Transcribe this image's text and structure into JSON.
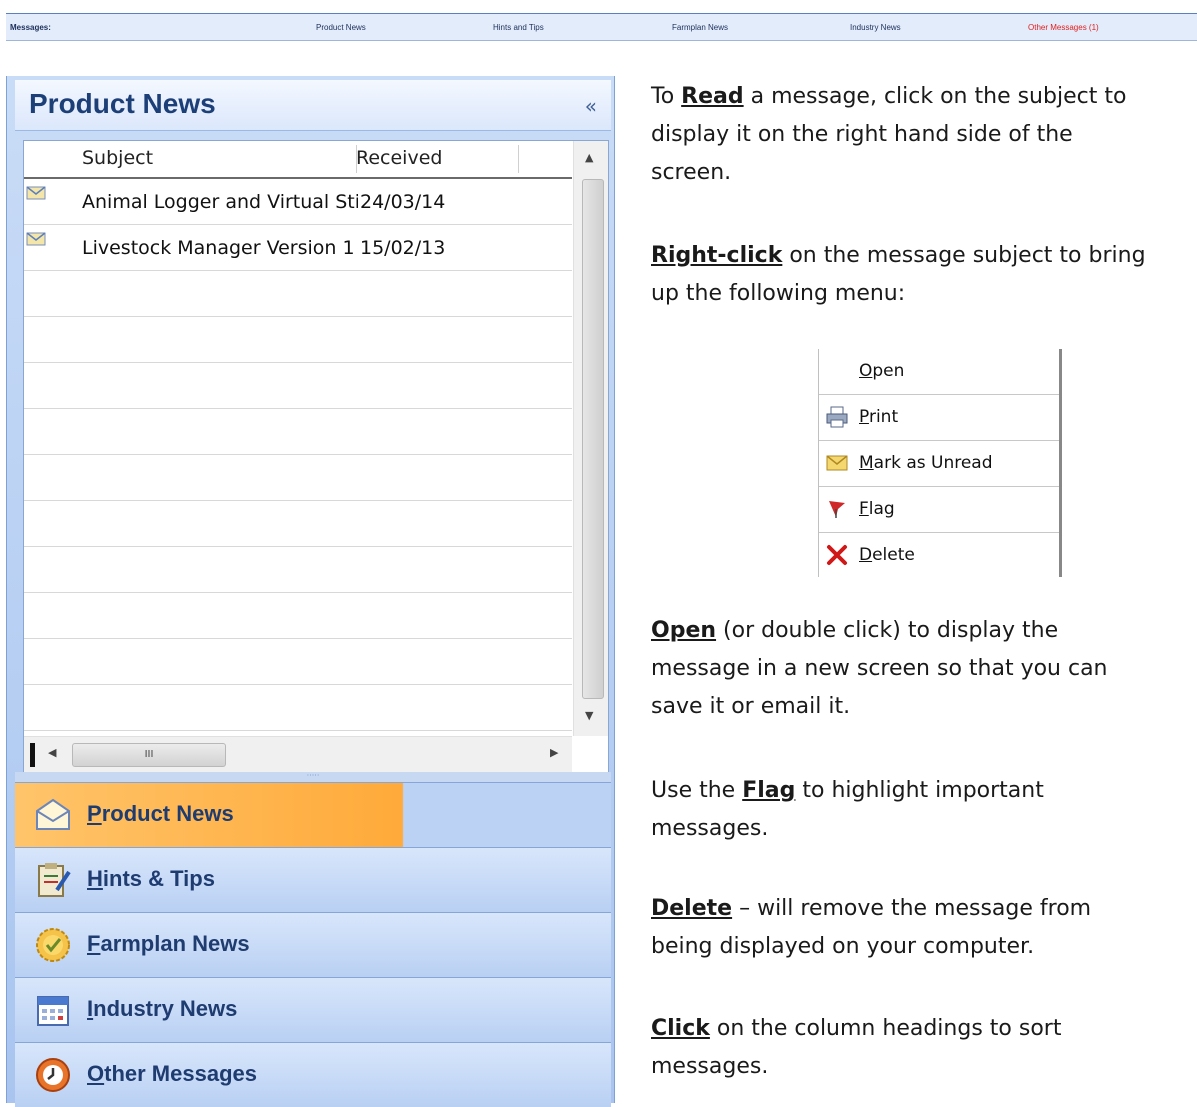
{
  "messages_bar": {
    "label": "Messages:",
    "tabs": [
      "Product News",
      "Hints and Tips",
      "Farmplan News",
      "Industry News",
      "Other Messages (1)"
    ]
  },
  "panel": {
    "title": "Product News",
    "collapse_glyph": "«",
    "columns": {
      "subject": "Subject",
      "received": "Received"
    },
    "rows": [
      {
        "subject": "Animal Logger and Virtual Sti",
        "received": "24/03/14",
        "icon": "envelope-icon"
      },
      {
        "subject": "Livestock Manager Version 1",
        "received": "15/02/13",
        "icon": "envelope-icon"
      }
    ],
    "hscroll_grip": "III",
    "splitter_grip": "·····"
  },
  "nav": {
    "items": [
      {
        "label": "Product News",
        "icon": "envelope-open-icon",
        "active": true
      },
      {
        "label": "Hints & Tips",
        "icon": "clipboard-pencil-icon",
        "active": false
      },
      {
        "label": "Farmplan News",
        "icon": "badge-check-icon",
        "active": false
      },
      {
        "label": "Industry News",
        "icon": "calendar-icon",
        "active": false
      },
      {
        "label": "Other Messages",
        "icon": "clock-arrow-icon",
        "active": false
      }
    ]
  },
  "instructions": {
    "read": {
      "pre": "To ",
      "kw": "Read",
      "post": " a message, click on the subject to",
      "line2": "display it on the right hand side of the",
      "line3": "screen."
    },
    "right_click": {
      "kw": "Right-click",
      "post": " on the message subject to bring",
      "line2": "up the following menu:"
    },
    "open": {
      "kw": "Open",
      "post": " (or double click) to display the",
      "line2": "message in a new screen so that you can",
      "line3": "save it or email it."
    },
    "flag": {
      "pre": "Use the ",
      "kw": "Flag",
      "post": " to highlight important",
      "line2": "messages."
    },
    "delete": {
      "kw": "Delete",
      "post": " – will remove the message from",
      "line2": "being displayed on your computer."
    },
    "click": {
      "kw": "Click",
      "post": " on the column headings to sort",
      "line2": "messages."
    }
  },
  "context_menu": {
    "items": [
      {
        "label": "Open",
        "icon": ""
      },
      {
        "label": "Print",
        "icon": "printer-icon"
      },
      {
        "label": "Mark as Unread",
        "icon": "envelope-icon"
      },
      {
        "label": "Flag",
        "icon": "flag-icon"
      },
      {
        "label": "Delete",
        "icon": "red-x-icon"
      }
    ]
  },
  "colors": {
    "accent": "#1d3f78",
    "active_nav": "#ffaa3a",
    "alert": "#e02020"
  }
}
